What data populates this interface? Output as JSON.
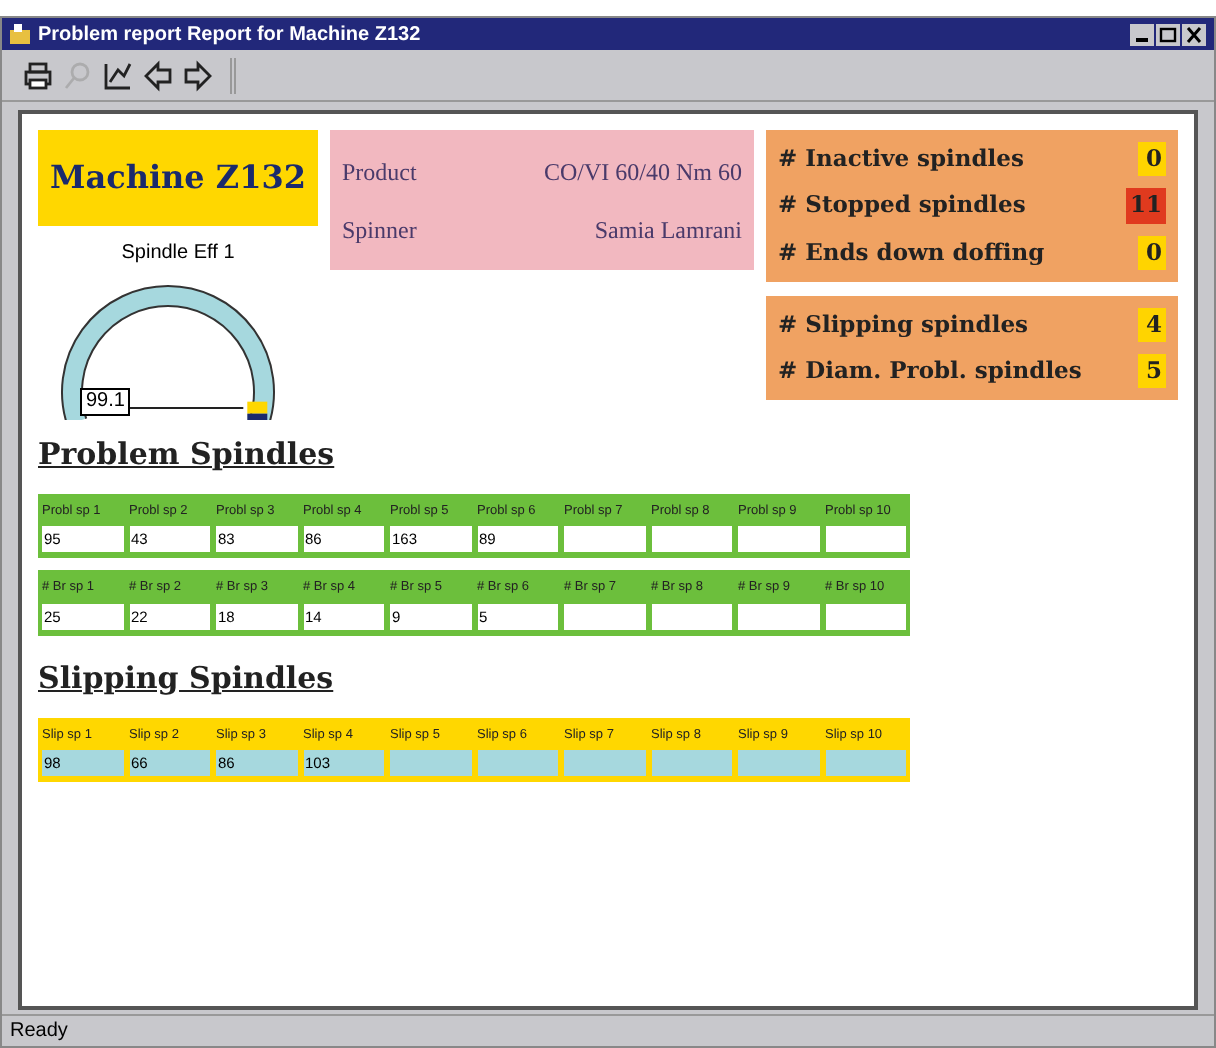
{
  "window": {
    "title": "Problem report Report for Machine Z132"
  },
  "toolbar": {
    "buttons": [
      {
        "kind": "print",
        "disabled": false
      },
      {
        "kind": "find",
        "disabled": true
      },
      {
        "kind": "chart",
        "disabled": false
      },
      {
        "kind": "back",
        "disabled": false
      },
      {
        "kind": "forward",
        "disabled": false
      }
    ]
  },
  "machine": {
    "title": "Machine Z132"
  },
  "info": [
    {
      "label": "Product",
      "value": "CO/VI 60/40  Nm 60"
    },
    {
      "label": "Spinner",
      "value": "Samia Lamrani"
    }
  ],
  "gauge": {
    "title": "Spindle Eff 1",
    "reading": "99.1"
  },
  "counters": [
    [
      {
        "label": "# Inactive spindles",
        "value": "0",
        "color": "#ffd400"
      },
      {
        "label": "# Stopped spindles",
        "value": "11",
        "color": "#e03a1e"
      },
      {
        "label": "# Ends down doffing",
        "value": "0",
        "color": "#ffd400"
      }
    ],
    [
      {
        "label": "# Slipping spindles",
        "value": "4",
        "color": "#ffd400"
      },
      {
        "label": "# Diam. Probl. spindles",
        "value": "5",
        "color": "#ffd400"
      }
    ]
  ],
  "sections": [
    {
      "heading": "Problem Spindles",
      "kind": "green",
      "tables": [
        {
          "columns": [
            "Probl sp 1",
            "Probl sp 2",
            "Probl sp 3",
            "Probl sp 4",
            "Probl sp 5",
            "Probl sp 6",
            "Probl sp 7",
            "Probl sp 8",
            "Probl sp 9",
            "Probl sp 10"
          ],
          "values": [
            "95",
            "43",
            "83",
            "86",
            "163",
            "89"
          ]
        },
        {
          "columns": [
            "# Br sp 1",
            "# Br sp 2",
            "# Br sp 3",
            "# Br sp 4",
            "# Br sp 5",
            "# Br sp 6",
            "# Br sp 7",
            "# Br sp 8",
            "# Br sp 9",
            "# Br sp 10"
          ],
          "values": [
            "25",
            "22",
            "18",
            "14",
            "9",
            "5"
          ]
        }
      ]
    },
    {
      "heading": "Slipping Spindles",
      "kind": "yellow",
      "tables": [
        {
          "columns": [
            "Slip sp 1",
            "Slip sp 2",
            "Slip sp 3",
            "Slip sp 4",
            "Slip sp 5",
            "Slip sp 6",
            "Slip sp 7",
            "Slip sp 8",
            "Slip sp 9",
            "Slip sp 10"
          ],
          "values": [
            "98",
            "66",
            "86",
            "103"
          ]
        }
      ]
    }
  ],
  "status_bar": {
    "text": "Ready"
  }
}
